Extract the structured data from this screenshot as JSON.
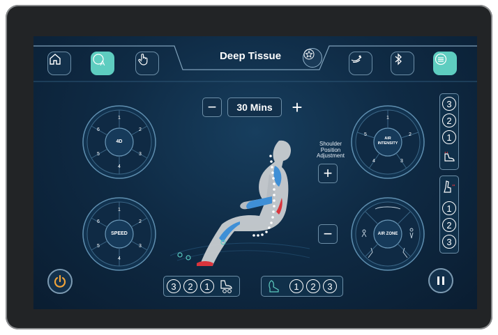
{
  "header": {
    "title": "Deep Tissue",
    "active_mode_letter": "A"
  },
  "timer": {
    "value": "30 Mins",
    "minus": "−",
    "plus": "+"
  },
  "dial_4d": {
    "center": "4D",
    "segments": [
      "1",
      "2",
      "3",
      "4",
      "5",
      "6"
    ]
  },
  "dial_speed": {
    "center": "SPEED",
    "segments": [
      "1",
      "2",
      "3",
      "4",
      "5",
      "6"
    ]
  },
  "dial_air_intensity": {
    "center_line1": "AIR",
    "center_line2": "INTENSITY",
    "segments": [
      "1",
      "2",
      "3",
      "4",
      "5"
    ]
  },
  "dial_air_zone": {
    "center": "AIR ZONE"
  },
  "shoulder": {
    "line1": "Shoulder",
    "line2": "Position",
    "line3": "Adjustment",
    "plus": "+",
    "minus": "−"
  },
  "foot_heat_levels": [
    "3",
    "2",
    "1"
  ],
  "back_heat_levels": [
    "1",
    "2",
    "3"
  ],
  "foot_roller_levels": [
    "3",
    "2",
    "1"
  ],
  "calf_levels": [
    "1",
    "2",
    "3"
  ],
  "colors": {
    "accent": "#5ecdc0",
    "background": "#0f2b45",
    "border": "#6d8fa8",
    "heat": "#d9343c"
  }
}
